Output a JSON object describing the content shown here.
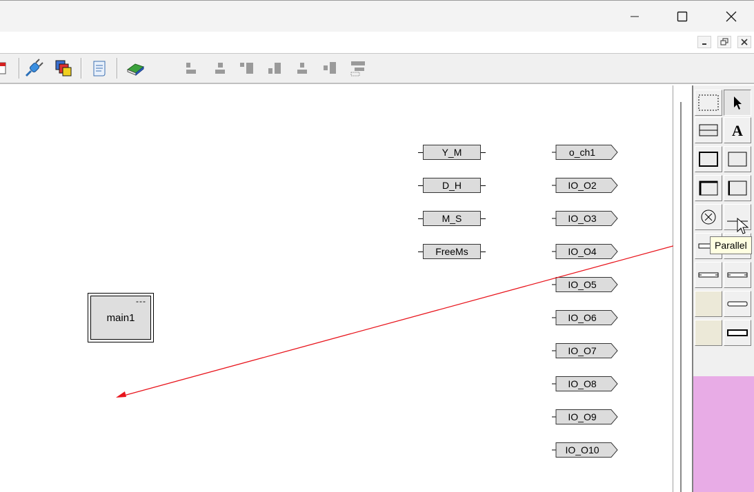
{
  "window": {
    "minimize_icon": "minimize-icon",
    "maximize_icon": "maximize-icon",
    "close_icon": "close-icon"
  },
  "mdi": {
    "minimize_icon": "mdi-minimize-icon",
    "restore_icon": "mdi-restore-icon",
    "close_icon": "mdi-close-icon"
  },
  "toolbar": {
    "icons": [
      "calendar-icon",
      "connect-plug-icon",
      "copy-windows-icon",
      "scroll-document-icon",
      "book-icon"
    ],
    "align_icons": [
      "align-left-icon",
      "align-center-icon",
      "align-right-icon",
      "align-top-icon",
      "align-middle-icon",
      "align-bottom-icon",
      "distribute-icon"
    ]
  },
  "canvas": {
    "input_variables": [
      "Y_M",
      "D_H",
      "M_S",
      "FreeMs"
    ],
    "output_variables": [
      "o_ch1",
      "IO_O2",
      "IO_O3",
      "IO_O4",
      "IO_O5",
      "IO_O6",
      "IO_O7",
      "IO_O8",
      "IO_O9",
      "IO_O10"
    ],
    "block": {
      "name": "main1",
      "instance": "---"
    },
    "connection_color": "#e8141c"
  },
  "palette": {
    "tools": [
      "select-rectangle-icon",
      "pointer-icon",
      "comment-box-icon",
      "text-tool-icon",
      "box-icon",
      "box-right-icon",
      "box-thick-left-icon",
      "box-thick-right-icon",
      "xor-circle-icon",
      "parallel-line-icon",
      "contact-icon",
      "contact-icon",
      "contact-2-icon",
      "contact-2-icon",
      "contact-3-icon",
      "contact-3-icon",
      "blank-icon",
      "contact-4-icon",
      "blank-icon",
      "coil-icon"
    ],
    "fill_color": "#e8ace6"
  },
  "tooltip": {
    "text": "Parallel"
  }
}
